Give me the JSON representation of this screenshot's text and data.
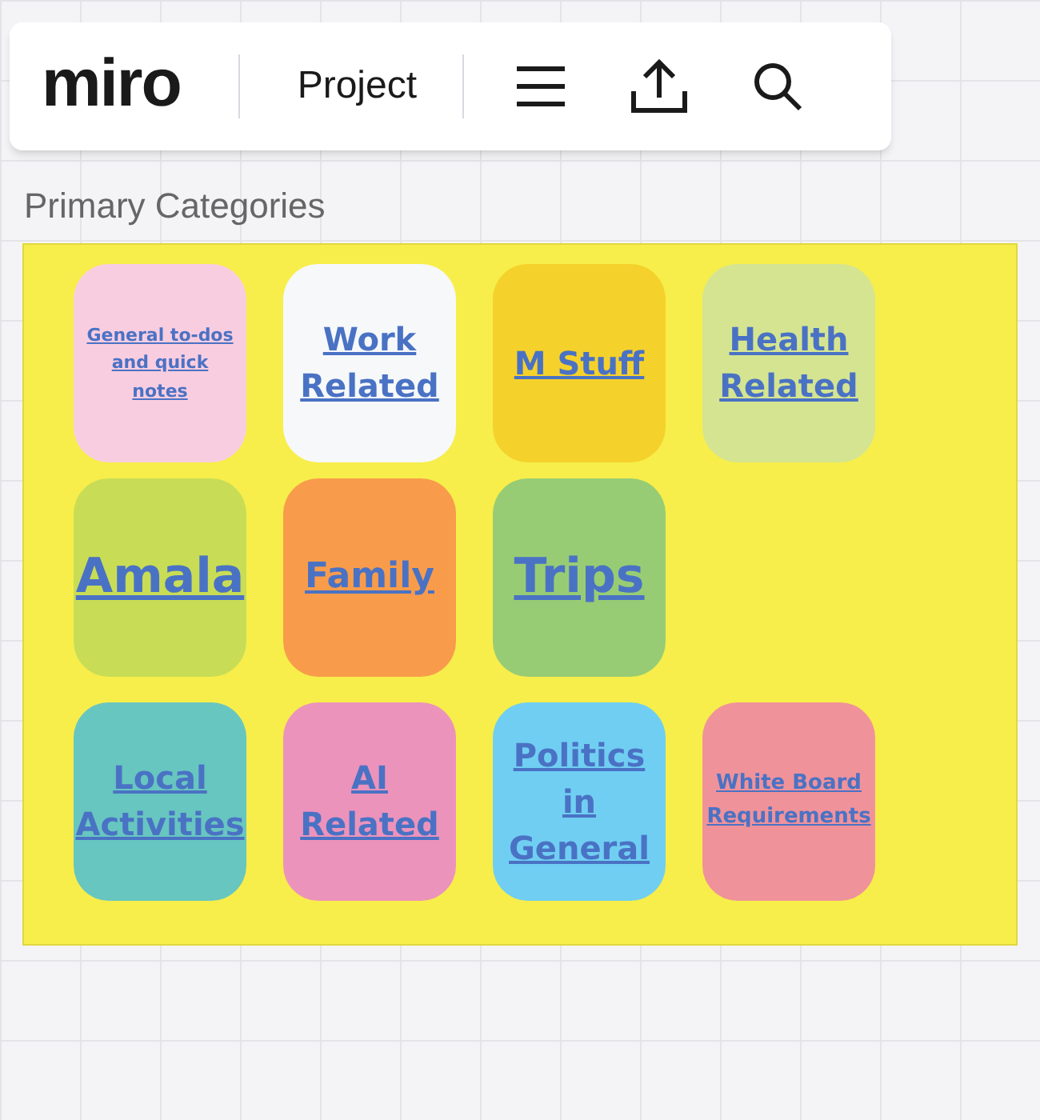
{
  "toolbar": {
    "logo": "miro",
    "board_name": "Project"
  },
  "frame": {
    "title": "Primary Categories",
    "cards": [
      {
        "label": "General to-dos and quick notes",
        "color": "#f9cde0"
      },
      {
        "label": "Work Related",
        "color": "#f6f8fa"
      },
      {
        "label": "M Stuff",
        "color": "#f5d12b"
      },
      {
        "label": "Health Related",
        "color": "#d5e491"
      },
      {
        "label": "Amala",
        "color": "#c8dd55"
      },
      {
        "label": "Family",
        "color": "#f89c4b"
      },
      {
        "label": "Trips",
        "color": "#98cc74"
      },
      {
        "label": "Local Activities",
        "color": "#67c6c0"
      },
      {
        "label": "AI Related",
        "color": "#ec93bb"
      },
      {
        "label": "Politics in General",
        "color": "#70cef2"
      },
      {
        "label": "White Board Requirements",
        "color": "#f0929a"
      }
    ]
  }
}
